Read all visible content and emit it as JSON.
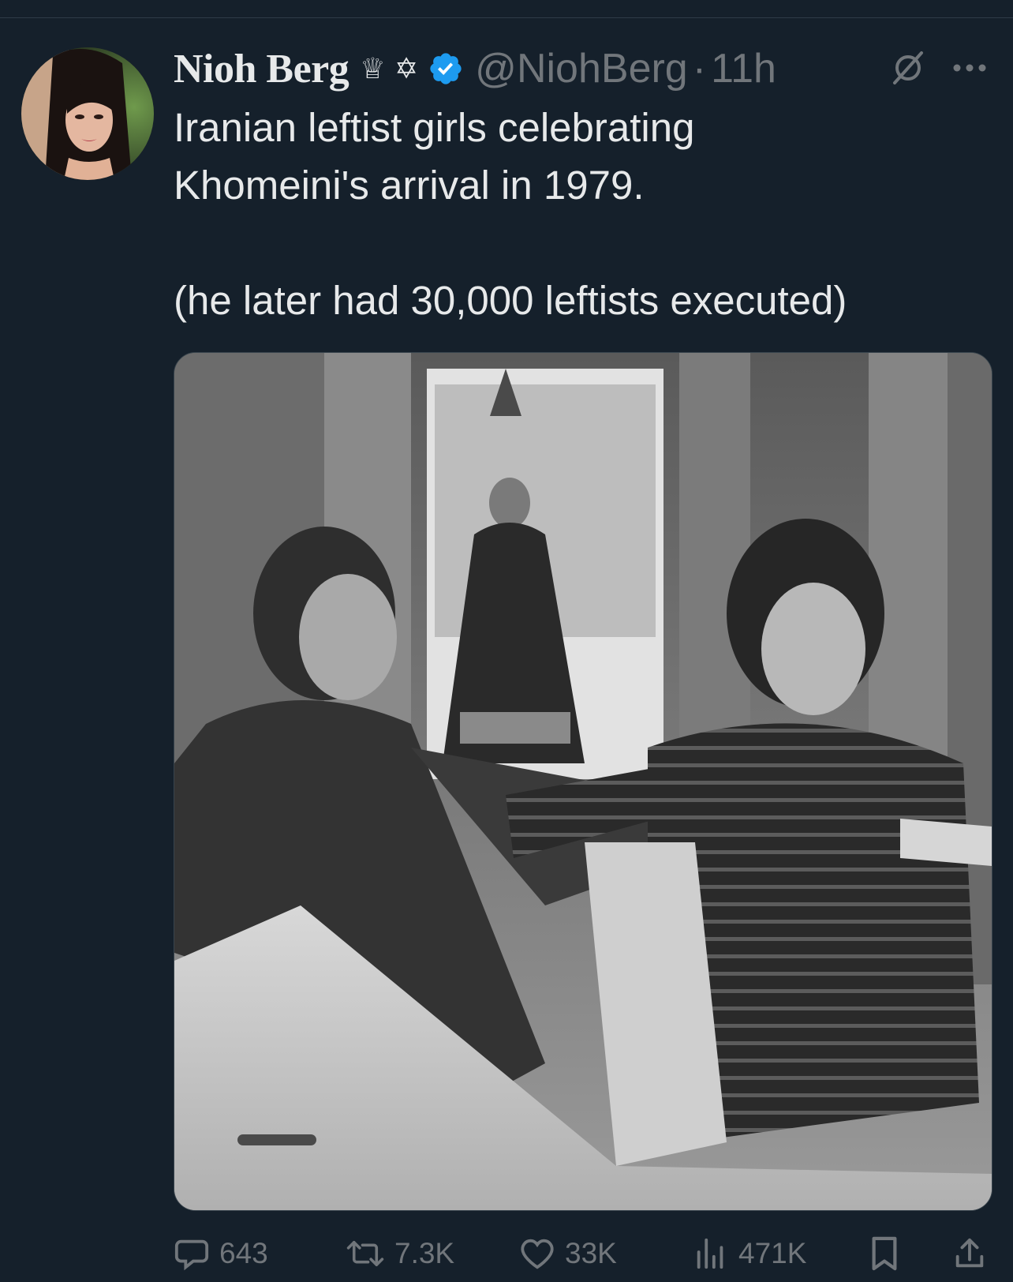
{
  "tweet": {
    "author": {
      "display_name": "Nioh Berg",
      "badges": "♕ ✡",
      "handle": "@NiohBerg",
      "time_separator": "·",
      "time": "11h",
      "verified_color": "#1d9bf0"
    },
    "text_line_1": "Iranian leftist girls celebrating",
    "text_line_2": "Khomeini's arrival in 1979.",
    "text_line_3": "(he later had 30,000 leftists executed)",
    "media": {
      "icon": "photo"
    },
    "actions": {
      "replies": "643",
      "reposts": "7.3K",
      "likes": "33K",
      "views": "471K"
    }
  },
  "colors": {
    "background": "#15202b",
    "text": "#e7e9ea",
    "muted": "#71767b"
  }
}
